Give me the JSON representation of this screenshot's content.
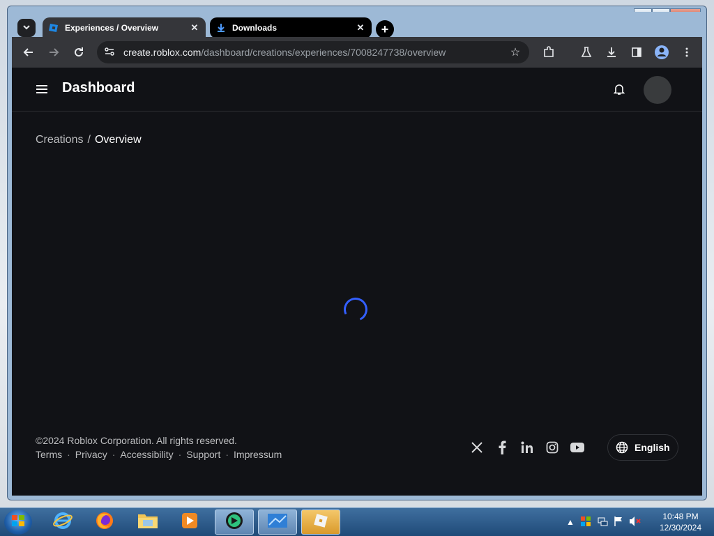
{
  "browser": {
    "tabs": [
      {
        "label": "Experiences / Overview",
        "active": true
      },
      {
        "label": "Downloads",
        "active": false
      }
    ],
    "url_host": "create.roblox.com",
    "url_path": "/dashboard/creations/experiences/7008247738/overview"
  },
  "window_controls": {
    "minimize": "—",
    "maximize": "□",
    "close": "X"
  },
  "page": {
    "header_title": "Dashboard",
    "breadcrumb": {
      "parent": "Creations",
      "separator": "/",
      "current": "Overview"
    },
    "footer": {
      "copyright": "©2024 Roblox Corporation. All rights reserved.",
      "links": [
        "Terms",
        "Privacy",
        "Accessibility",
        "Support",
        "Impressum"
      ],
      "separator": "·",
      "language_label": "English"
    },
    "social_icons": [
      "x-icon",
      "facebook-icon",
      "linkedin-icon",
      "instagram-icon",
      "youtube-icon"
    ]
  },
  "taskbar": {
    "clock_time": "10:48 PM",
    "clock_date": "12/30/2024"
  },
  "colors": {
    "page_bg": "#111216",
    "spinner": "#335fff",
    "toolbar_bg": "#35363a"
  }
}
